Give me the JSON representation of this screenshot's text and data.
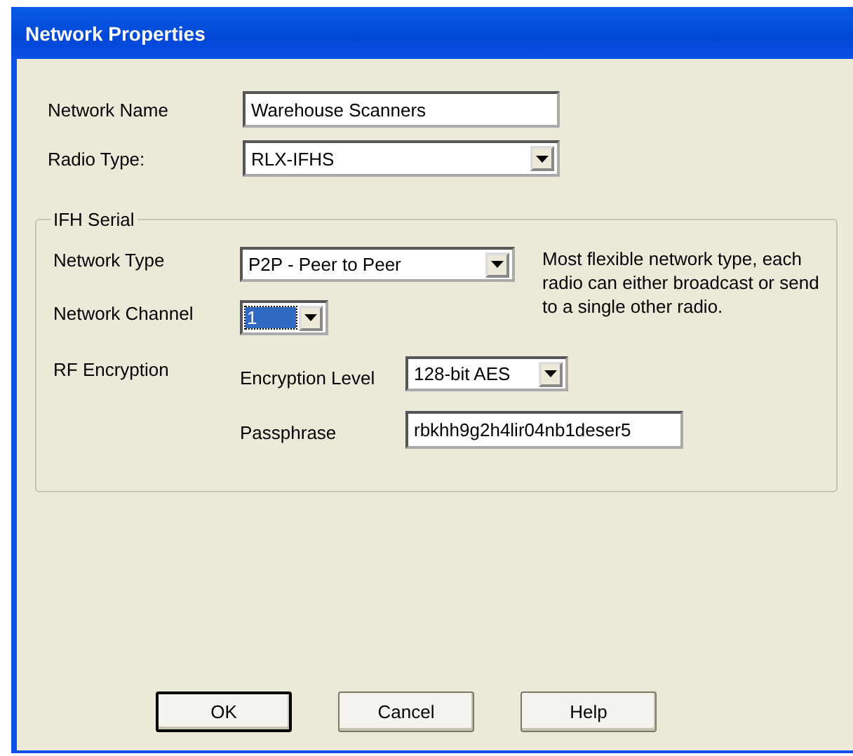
{
  "window": {
    "title": "Network Properties"
  },
  "fields": [
    {
      "label": "Network Name",
      "kind": "text",
      "value": "Warehouse Scanners"
    },
    {
      "label": "Radio Type:",
      "kind": "combo",
      "value": "RLX-IFHS"
    }
  ],
  "group": {
    "title": "IFH Serial",
    "network_type": {
      "label": "Network Type",
      "value": "P2P - Peer to Peer",
      "description": "Most flexible network type, each radio can either broadcast or send to a single other radio."
    },
    "network_channel": {
      "label": "Network Channel",
      "value": "1",
      "focused": true
    },
    "rf_encryption": {
      "label": "RF Encryption",
      "level_label": "Encryption Level",
      "level_value": "128-bit AES",
      "passphrase_label": "Passphrase",
      "passphrase_value": "rbkhh9g2h4lir04nb1deser5"
    }
  },
  "buttons": [
    {
      "label": "OK",
      "default": true
    },
    {
      "label": "Cancel",
      "default": false
    },
    {
      "label": "Help",
      "default": false
    }
  ]
}
